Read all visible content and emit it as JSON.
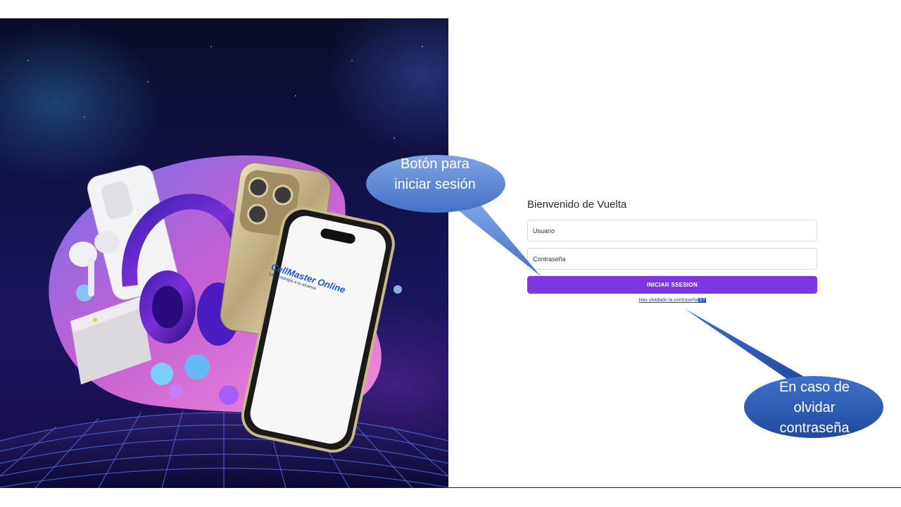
{
  "hero": {
    "brand_name": "CellMaster Online",
    "brand_tagline": "La tecnología a tu alcance"
  },
  "login": {
    "welcome": "Bienvenido de Vuelta",
    "username_placeholder": "Usuario",
    "password_placeholder": "Contraseña",
    "submit_label": "INICIAR SSESION",
    "forgot_text": "Has olvidado la contraseña",
    "forgot_suffix": "S?"
  },
  "annotations": {
    "login_callout": "Botón para iniciar sesión",
    "forgot_callout": "En caso de olvidar contraseña"
  },
  "colors": {
    "button": "#7f35e0",
    "callout_fill": "#5a84cf",
    "link": "#1a4fb0"
  }
}
